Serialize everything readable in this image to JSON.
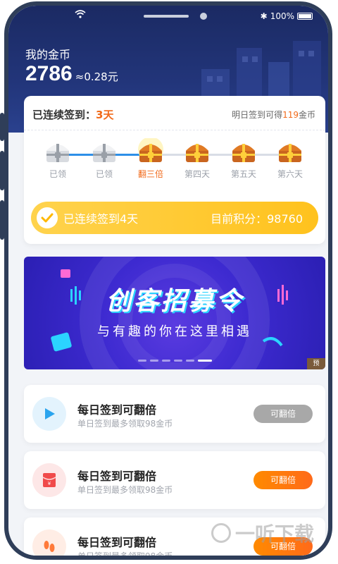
{
  "status_bar": {
    "battery": "100%"
  },
  "wallet": {
    "title": "我的金币",
    "amount": "2786",
    "rmb_value": "≈0.28元"
  },
  "checkin": {
    "streak_label": "已连续签到：",
    "streak_days": "3天",
    "tomorrow_prefix": "明日签到可得",
    "tomorrow_amount": "119",
    "tomorrow_suffix": "金币",
    "days": [
      {
        "label": "已领",
        "state": "claimed"
      },
      {
        "label": "已领",
        "state": "claimed"
      },
      {
        "label": "翻三倍",
        "state": "today"
      },
      {
        "label": "第四天",
        "state": "locked"
      },
      {
        "label": "第五天",
        "state": "locked"
      },
      {
        "label": "第六天",
        "state": "locked"
      }
    ],
    "summary_left": "已连续签到4天",
    "summary_right": "目前积分：98760"
  },
  "banner": {
    "title": "创客招募令",
    "subtitle": "与有趣的你在这里相遇",
    "slide_count": 6,
    "active_slide": 6,
    "tag": "预"
  },
  "tasks": [
    {
      "title": "每日签到可翻倍",
      "subtitle": "单日签到最多领取98金币",
      "button": "可翻倍",
      "button_state": "disabled",
      "icon": "play-icon",
      "icon_color": "#2aa4ee"
    },
    {
      "title": "每日签到可翻倍",
      "subtitle": "单日签到最多领取98金币",
      "button": "可翻倍",
      "button_state": "active",
      "icon": "red-envelope-icon",
      "icon_color": "#f04a4a"
    },
    {
      "title": "每日签到可翻倍",
      "subtitle": "单日签到最多领取98金币",
      "button": "可翻倍",
      "button_state": "active",
      "icon": "footprints-icon",
      "icon_color": "#ff7a3a"
    }
  ],
  "watermark": "一听下载",
  "colors": {
    "accent_orange": "#f16a1a",
    "header_navy": "#1b2a63",
    "pill_yellow": "#ffc21d",
    "progress_blue": "#2d8fe8"
  }
}
